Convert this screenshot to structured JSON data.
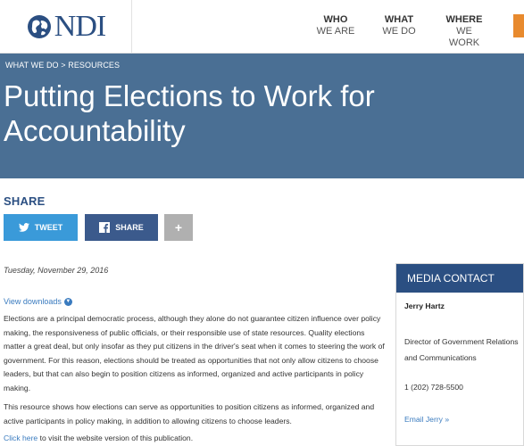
{
  "header": {
    "logo_text": "NDI",
    "nav": [
      {
        "line1": "WHO",
        "line2": "WE ARE"
      },
      {
        "line1": "WHAT",
        "line2": "WE DO"
      },
      {
        "line1": "WHERE",
        "line2": "WE WORK"
      }
    ],
    "accent_color": "#e88a2e"
  },
  "banner": {
    "breadcrumb": "WHAT WE DO > RESOURCES",
    "title": "Putting Elections to Work for Accountability",
    "background": "#4a6f94"
  },
  "share": {
    "heading": "SHARE",
    "tweet_label": "TWEET",
    "facebook_label": "SHARE",
    "more_label": "+"
  },
  "article": {
    "date": "Tuesday, November 29, 2016",
    "downloads_label": "View downloads",
    "paragraph1": "Elections are a principal democratic process, although they alone do not guarantee citizen influence over policy making, the responsiveness of public officials, or their responsible use of state resources. Quality elections matter a great deal, but only insofar as they put citizens in the driver's seat when it comes to steering the work of government. For this reason, elections should be treated as opportunities that not only allow citizens to choose leaders, but that can also begin to position citizens as informed, organized and active participants in policy making.",
    "paragraph2": "This resource shows how elections can serve as opportunities to position citizens as informed, organized and active participants in policy making, in addition to allowing citizens to choose leaders.",
    "link_label": "Click here",
    "link_suffix": " to visit the website version of this publication."
  },
  "media_contact": {
    "heading": "MEDIA CONTACT",
    "name": "Jerry Hartz",
    "role": "Director of Government Relations and Communications",
    "phone": "1 (202) 728-5500",
    "email_label": "Email Jerry »"
  }
}
